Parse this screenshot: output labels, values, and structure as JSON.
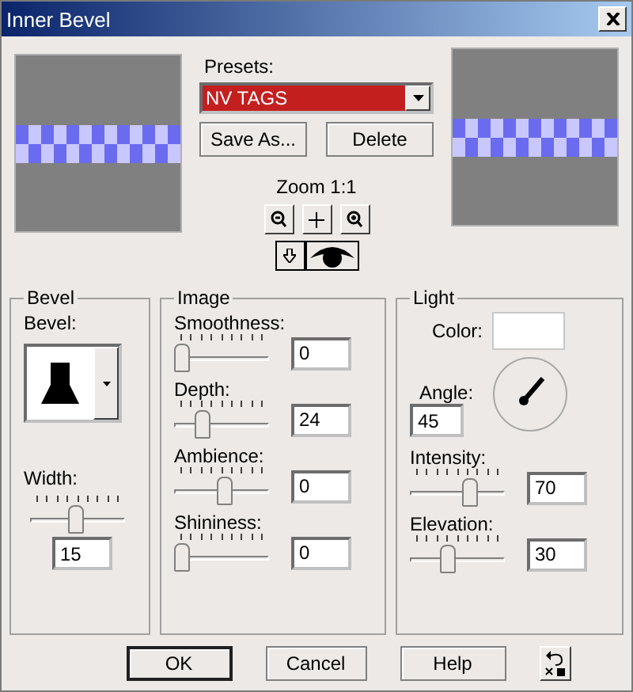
{
  "window": {
    "title": "Inner Bevel"
  },
  "presets": {
    "label": "Presets:",
    "value": "NV TAGS",
    "buttons": [
      "Save As...",
      "Delete"
    ]
  },
  "zoom": {
    "label": "Zoom 1:1"
  },
  "bevel": {
    "title": "Bevel",
    "shape_label": "Bevel:",
    "width": {
      "label": "Width:",
      "value": "15",
      "level": 0.47
    }
  },
  "image": {
    "title": "Image",
    "sliders": [
      {
        "label": "Smoothness:",
        "value": "0",
        "level": 0
      },
      {
        "label": "Depth:",
        "value": "24",
        "level": 0.25
      },
      {
        "label": "Ambience:",
        "value": "0",
        "level": 0.53
      },
      {
        "label": "Shininess:",
        "value": "0",
        "level": 0
      }
    ]
  },
  "light": {
    "title": "Light",
    "color_label": "Color:",
    "angle_label": "Angle:",
    "angle_value": "45",
    "sliders": [
      {
        "label": "Intensity:",
        "value": "70",
        "level": 0.65
      },
      {
        "label": "Elevation:",
        "value": "30",
        "level": 0.38
      }
    ]
  },
  "buttons": [
    {
      "label": "OK",
      "default": true
    },
    {
      "label": "Cancel",
      "default": false
    },
    {
      "label": "Help",
      "default": false
    }
  ]
}
